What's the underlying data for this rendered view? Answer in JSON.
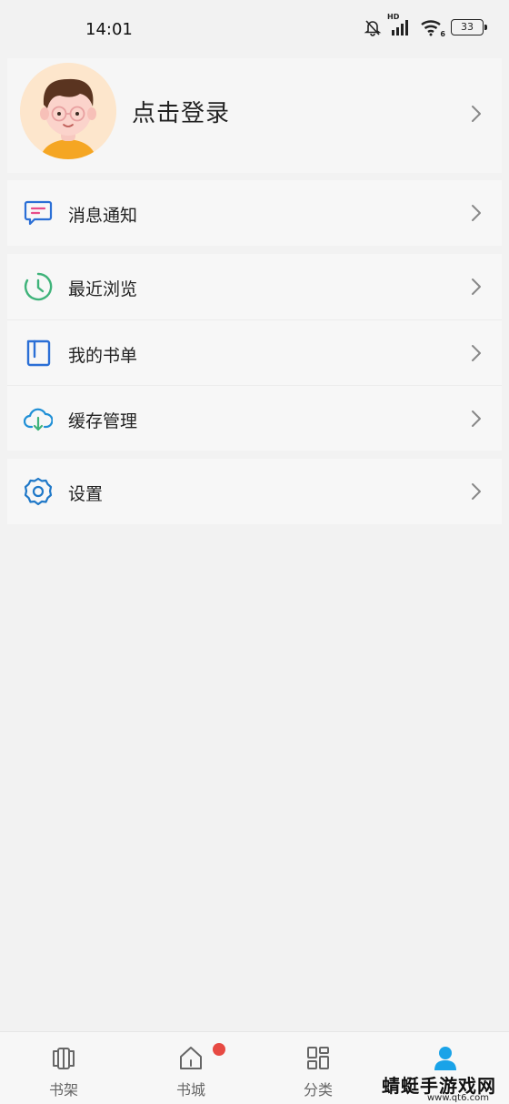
{
  "status_bar": {
    "time": "14:01",
    "network_label": "HD",
    "wifi_sub": "6",
    "battery": "33",
    "icons": [
      "mute-bell-icon",
      "signal-icon",
      "wifi-icon",
      "battery-icon"
    ]
  },
  "profile": {
    "login_label": "点击登录",
    "avatar": "cartoon-boy-avatar"
  },
  "menu_groups": [
    [
      {
        "label": "消息通知",
        "icon": "message-icon"
      }
    ],
    [
      {
        "label": "最近浏览",
        "icon": "clock-icon"
      },
      {
        "label": "我的书单",
        "icon": "book-icon"
      },
      {
        "label": "缓存管理",
        "icon": "cloud-download-icon"
      }
    ],
    [
      {
        "label": "设置",
        "icon": "gear-icon"
      }
    ]
  ],
  "bottom_nav": {
    "items": [
      {
        "label": "书架",
        "icon": "bookshelf-icon",
        "active": false
      },
      {
        "label": "书城",
        "icon": "home-icon",
        "active": false,
        "badge": true
      },
      {
        "label": "分类",
        "icon": "grid-icon",
        "active": false
      },
      {
        "label": "",
        "icon": "user-icon",
        "active": true
      }
    ],
    "active_color": "#1aa3e8"
  },
  "watermark": {
    "text": "蜻蜓手游戏网",
    "url": "www.qt6.com"
  },
  "colors": {
    "message_icon": "#2b6fd6",
    "message_accent": "#e84d8a",
    "clock_icon": "#3fb37a",
    "book_icon": "#2b6fd6",
    "cloud_icon": "#1f8fd6",
    "cloud_arrow": "#3fb37a",
    "gear_icon": "#1f78c8"
  }
}
